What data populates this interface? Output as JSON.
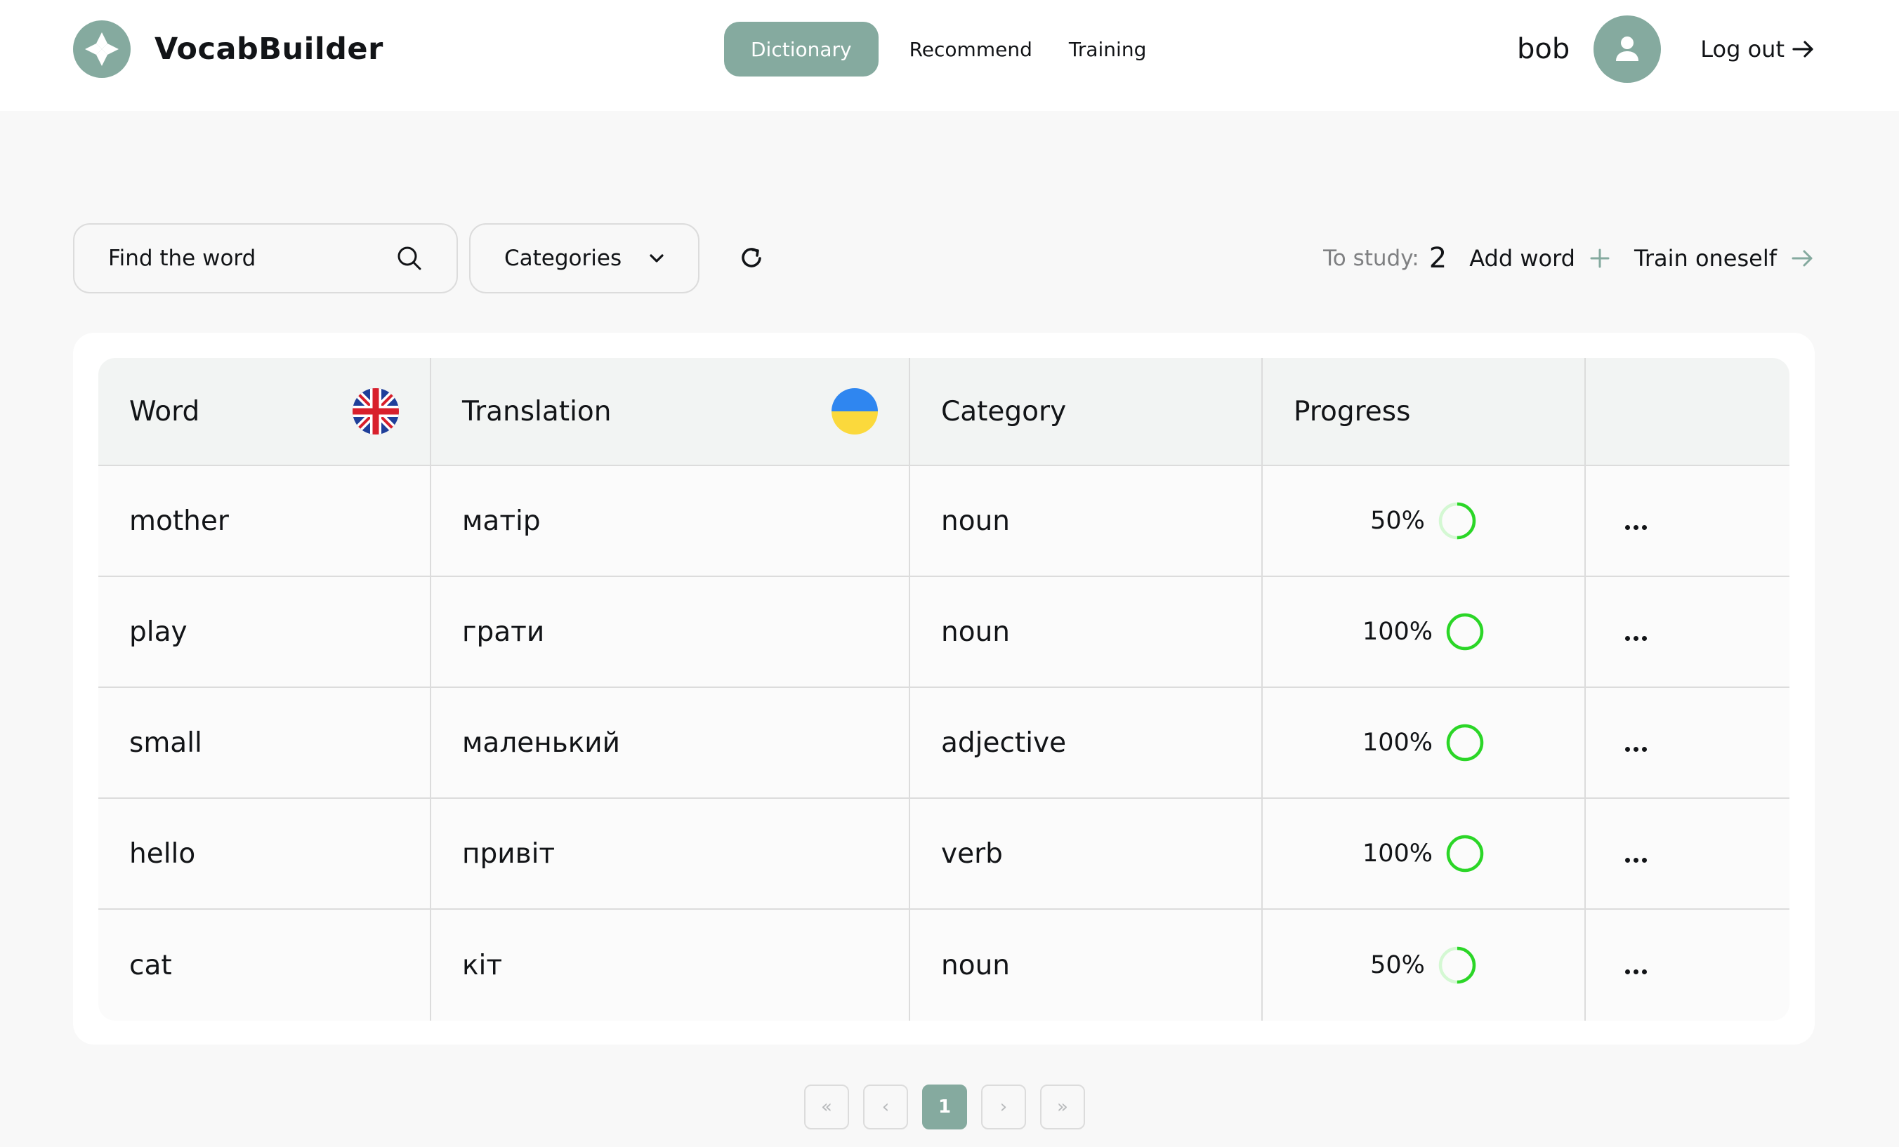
{
  "colors": {
    "accent": "#85aa9f",
    "progress": "#2bd627",
    "progress_track": "#d4f8d3",
    "text": "#121417",
    "muted": "#7f8082",
    "border": "#dcdcdc"
  },
  "header": {
    "brand": "VocabBuilder",
    "nav": [
      {
        "label": "Dictionary",
        "active": true
      },
      {
        "label": "Recommend",
        "active": false
      },
      {
        "label": "Training",
        "active": false
      }
    ],
    "user_name": "bob",
    "logout_label": "Log out"
  },
  "toolbar": {
    "search_placeholder": "Find the word",
    "categories_label": "Categories",
    "to_study_label": "To study:",
    "to_study_count": "2",
    "add_word_label": "Add word",
    "train_label": "Train oneself"
  },
  "table": {
    "headers": {
      "word": "Word",
      "translation": "Translation",
      "category": "Category",
      "progress": "Progress"
    },
    "rows": [
      {
        "word": "mother",
        "translation": "матір",
        "category": "noun",
        "progress_label": "50%",
        "progress": 0.5
      },
      {
        "word": "play",
        "translation": "грати",
        "category": "noun",
        "progress_label": "100%",
        "progress": 1.0
      },
      {
        "word": "small",
        "translation": "маленький",
        "category": "adjective",
        "progress_label": "100%",
        "progress": 1.0
      },
      {
        "word": "hello",
        "translation": "привіт",
        "category": "verb",
        "progress_label": "100%",
        "progress": 1.0
      },
      {
        "word": "cat",
        "translation": "кіт",
        "category": "noun",
        "progress_label": "50%",
        "progress": 0.5
      }
    ]
  },
  "pagination": {
    "first": "«",
    "prev": "‹",
    "current": "1",
    "next": "›",
    "last": "»"
  }
}
